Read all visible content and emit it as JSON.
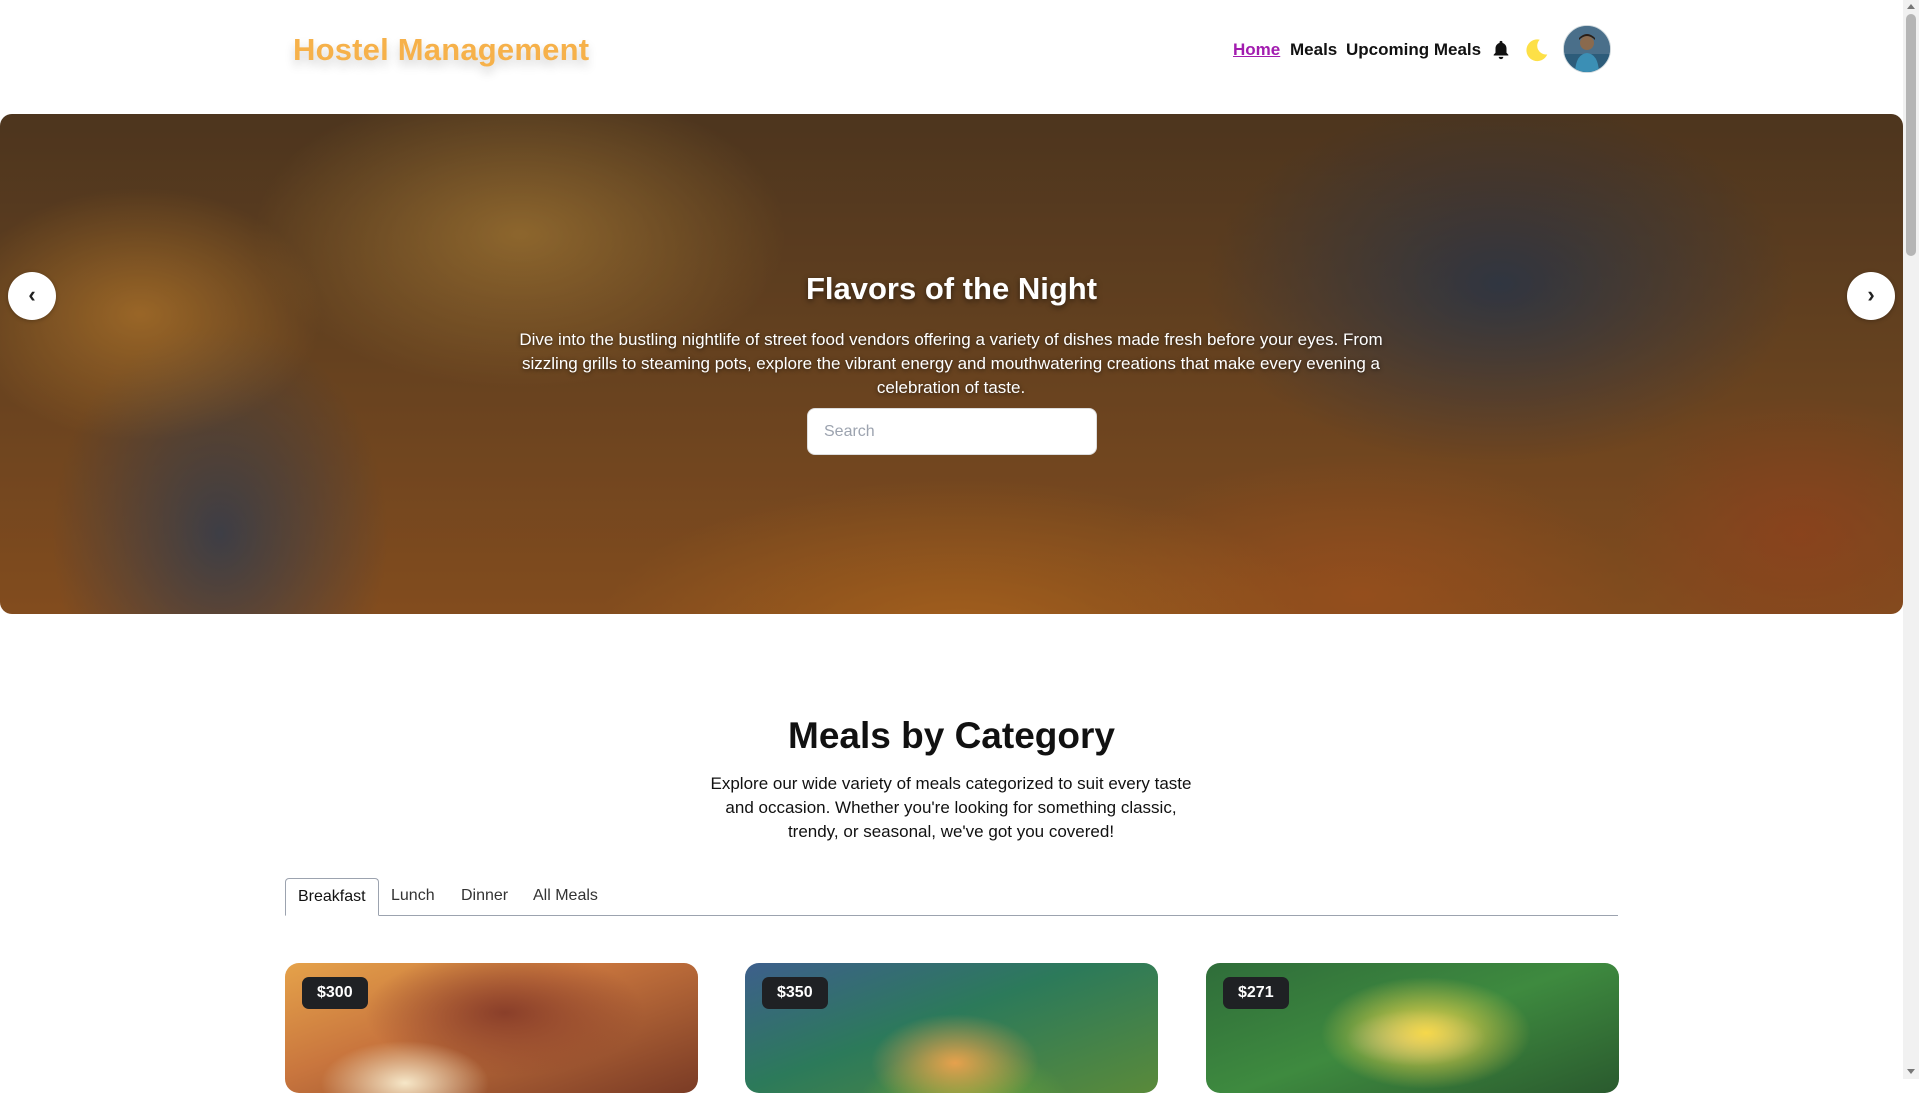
{
  "header": {
    "logo": "Hostel Management",
    "nav": {
      "home": "Home",
      "meals": "Meals",
      "upcoming": "Upcoming Meals"
    },
    "icons": [
      "bell-icon",
      "moon-icon"
    ],
    "colors": {
      "logo": "#f6b14a",
      "active_nav": "#a21caf",
      "moon": "#fde047"
    }
  },
  "hero": {
    "title": "Flavors of the Night",
    "description": "Dive into the bustling nightlife of street food vendors offering a variety of dishes made fresh before your eyes. From sizzling grills to steaming pots, explore the vibrant energy and mouthwatering creations that make every evening a celebration of taste.",
    "search_placeholder": "Search",
    "search_value": "",
    "prev_label": "‹",
    "next_label": "›"
  },
  "category_section": {
    "title": "Meals by Category",
    "description": "Explore our wide variety of meals categorized to suit every taste and occasion. Whether you're looking for something classic, trendy, or seasonal, we've got you covered!",
    "tabs": [
      {
        "label": "Breakfast",
        "active": true
      },
      {
        "label": "Lunch",
        "active": false
      },
      {
        "label": "Dinner",
        "active": false
      },
      {
        "label": "All Meals",
        "active": false
      }
    ],
    "cards": [
      {
        "price": "$300"
      },
      {
        "price": "$350"
      },
      {
        "price": "$271"
      }
    ]
  }
}
